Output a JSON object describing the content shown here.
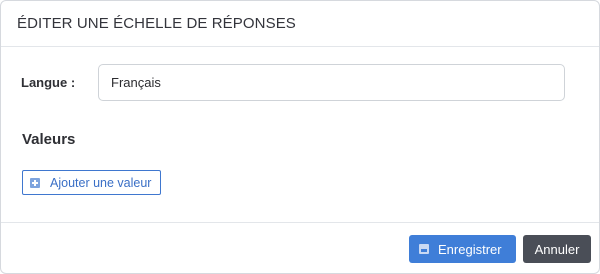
{
  "modal": {
    "title": "ÉDITER UNE ÉCHELLE DE RÉPONSES"
  },
  "form": {
    "language_label": "Langue :",
    "language_value": "Français",
    "values_heading": "Valeurs",
    "add_value_label": "Ajouter une valeur",
    "add_value_icon": "plus-icon"
  },
  "footer": {
    "save_label": "Enregistrer",
    "save_icon": "floppy-disk-icon",
    "cancel_label": "Annuler"
  },
  "colors": {
    "primary": "#3f7ed8",
    "secondary": "#4a4e57",
    "border": "#cfd3d8"
  }
}
